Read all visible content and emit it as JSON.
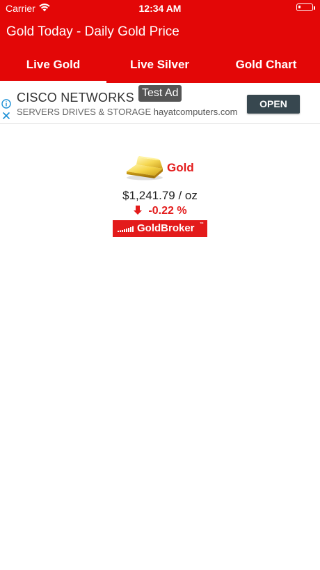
{
  "status_bar": {
    "carrier": "Carrier",
    "time": "12:34 AM"
  },
  "app": {
    "title": "Gold Today - Daily Gold Price"
  },
  "tabs": [
    {
      "label": "Live Gold",
      "selected": true
    },
    {
      "label": "Live Silver",
      "selected": false
    },
    {
      "label": "Gold Chart",
      "selected": false
    }
  ],
  "ad": {
    "headline": "CISCO NETWORKS LINKS",
    "subline": "SERVERS DRIVES & STORAGE",
    "domain": "hayatcomputers.com",
    "badge": "Test Ad",
    "cta": "OPEN"
  },
  "quote": {
    "metal": "Gold",
    "price": "$1,241.79 / oz",
    "change": "-0.22 %"
  },
  "broker": {
    "name": "GoldBroker",
    "trademark": "™"
  },
  "colors": {
    "brand_red": "#e30707",
    "accent_red": "#e31b1b",
    "ad_button": "#37474f"
  }
}
